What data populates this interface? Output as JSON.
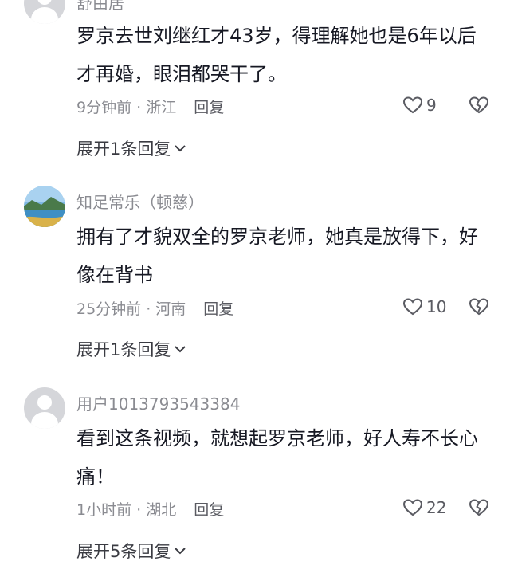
{
  "comments": [
    {
      "username": "舒由居",
      "avatar": "default",
      "text": "罗京去世刘继红才43岁，得理解她也是6年以后才再婚，眼泪都哭干了。",
      "time_location": "9分钟前 · 浙江",
      "reply_label": "回复",
      "likes": "9",
      "expand_label": "展开1条回复"
    },
    {
      "username": "知足常乐（顿慈）",
      "avatar": "landscape",
      "text": "拥有了才貌双全的罗京老师，她真是放得下，好像在背书",
      "time_location": "25分钟前 · 河南",
      "reply_label": "回复",
      "likes": "10",
      "expand_label": "展开1条回复"
    },
    {
      "username": "用户1013793543384",
      "avatar": "default",
      "text": "看到这条视频，就想起罗京老师，好人寿不长心痛！",
      "time_location": "1小时前 · 湖北",
      "reply_label": "回复",
      "likes": "22",
      "expand_label": "展开5条回复"
    }
  ],
  "icons": {
    "like": "heart-outline-icon",
    "dislike": "broken-heart-icon",
    "expand": "chevron-down-icon"
  },
  "colors": {
    "text": "#161823",
    "secondary": "#8a8b91"
  }
}
